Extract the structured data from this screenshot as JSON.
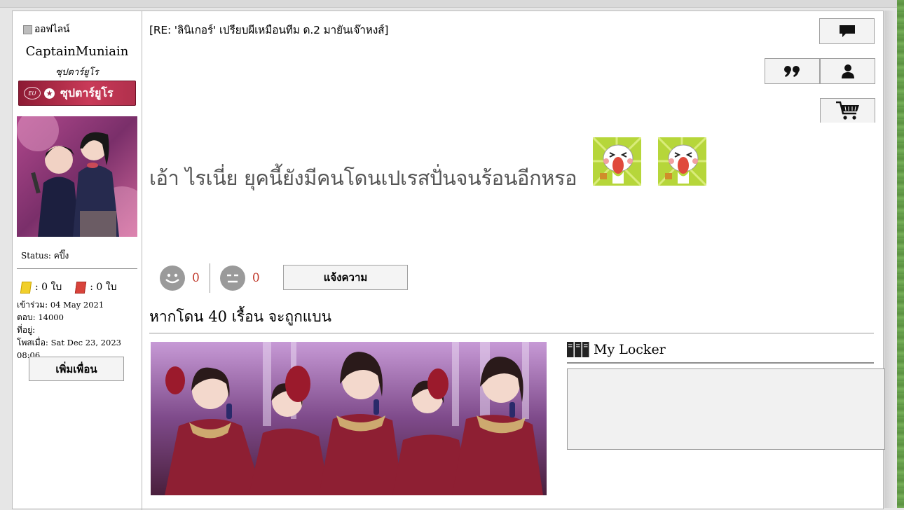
{
  "user": {
    "online_status": "ออฟไลน์",
    "username": "CaptainMuniain",
    "rank_title": "ซุปตาร์ยูโร",
    "rank_badge": {
      "emblem": "EU",
      "label": "ซุปตาร์ยูโร"
    },
    "status_label": "Status:",
    "status_value": "คปิ๊ง",
    "yellow_cards": ": 0 ใบ",
    "red_cards": ": 0 ใบ",
    "joined_label": "เข้าร่วม:",
    "joined_value": "04 May 2021",
    "replies_label": "ตอบ:",
    "replies_value": "14000",
    "location_label": "ที่อยู่:",
    "location_value": "",
    "posted_label": "โพสเมื่อ:",
    "posted_value": "Sat Dec 23, 2023 08:06",
    "add_friend_label": "เพิ่มเพื่อน"
  },
  "post": {
    "title": "[RE: 'ลินิเกอร์' เปรียบผีเหมือนทีม ด.2 มายันเจ๊าหงส์]",
    "body": "เอ้า ไรเนี่ย ยุคนี้ยังมีคนโดนเปเรสปั่นจนร้อนอีกหรอ",
    "reactions": {
      "like_count": "0",
      "dislike_count": "0"
    },
    "report_label": "แจ้งความ"
  },
  "toolbar": {
    "icons": [
      "comment-icon",
      "quote-icon",
      "user-icon",
      "cart-icon"
    ]
  },
  "signature": {
    "ban_text": "หากโดน 40 เรื้อน จะถูกแบน"
  },
  "locker": {
    "title": "My Locker"
  },
  "colors": {
    "rank_banner": "#b0304c",
    "reaction_count": "#c0392b",
    "button_bg": "#f3f3f3"
  }
}
